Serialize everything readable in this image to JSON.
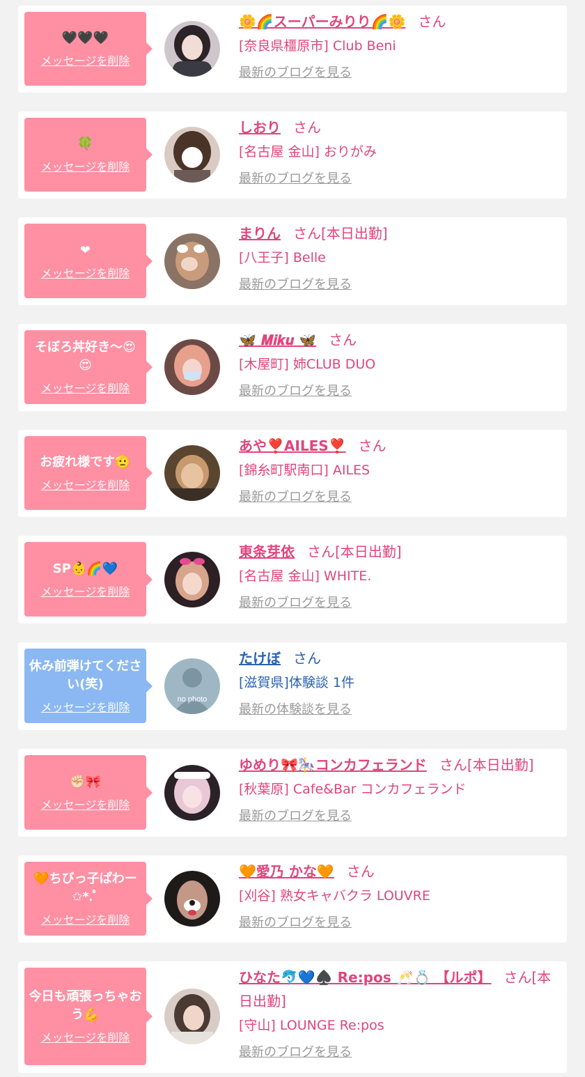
{
  "colors": {
    "background": "#f2f2f2",
    "card": "#ffffff",
    "bubble_pink": "#ff8fa3",
    "bubble_blue": "#8bb8f3",
    "name_pink": "#e0457b",
    "name_blue": "#2a62b0",
    "link_gray": "#999999"
  },
  "delete_label": "メッセージを削除",
  "items": [
    {
      "message": "🖤🖤🖤",
      "name": "🌼🌈スーパーみりり🌈🌼",
      "honorific": "さん",
      "status": "",
      "shop": "[奈良県橿原市] Club Beni",
      "link": "最新のブログを見る",
      "theme": "pink",
      "avatar_icon": "girl-photo-avatar-icon"
    },
    {
      "message": "🍀",
      "name": "しおり",
      "honorific": "さん",
      "status": "",
      "shop": "[名古屋 金山] おりがみ",
      "link": "最新のブログを見る",
      "theme": "pink",
      "avatar_icon": "girl-photo-avatar-icon"
    },
    {
      "message": "❤",
      "name": "まりん",
      "honorific": "さん",
      "status": "[本日出勤]",
      "shop": "[八王子] Belle",
      "link": "最新のブログを見る",
      "theme": "pink",
      "avatar_icon": "girl-photo-avatar-icon"
    },
    {
      "message": "そぼろ丼好き〜😍😍",
      "name": "🦋 𝑴𝒊𝒌𝒖 🦋",
      "honorific": "さん",
      "status": "",
      "shop": "[木屋町] 姉CLUB DUO",
      "link": "最新のブログを見る",
      "theme": "pink",
      "avatar_icon": "girl-photo-avatar-icon"
    },
    {
      "message": "お疲れ様です🫡",
      "name": "あや❣️AILES❣️",
      "honorific": "さん",
      "status": "",
      "shop": "[錦糸町駅南口] AILES",
      "link": "最新のブログを見る",
      "theme": "pink",
      "avatar_icon": "girl-photo-avatar-icon"
    },
    {
      "message": "SP👶🌈💙",
      "name": "東条芽依",
      "honorific": "さん",
      "status": "[本日出勤]",
      "shop": "[名古屋 金山] WHITE.",
      "link": "最新のブログを見る",
      "theme": "pink",
      "avatar_icon": "girl-photo-avatar-icon"
    },
    {
      "message": "休み前弾けてください(笑)",
      "name": "たけぼ",
      "honorific": "さん",
      "status": "",
      "shop": "[滋賀県]体験談 1件",
      "link": "最新の体験談を見る",
      "theme": "blue",
      "avatar_icon": "no-photo-avatar-icon",
      "avatar_text": "no photo"
    },
    {
      "message": "✊🏻🎀",
      "name": "ゆめり🎀🎠コンカフェランド",
      "honorific": "さん",
      "status": "[本日出勤]",
      "shop": "[秋葉原] Cafe&Bar コンカフェランド",
      "link": "最新のブログを見る",
      "theme": "pink",
      "avatar_icon": "girl-photo-avatar-icon"
    },
    {
      "message": "🧡ちびっ子ぱわー✩*.ﾟ",
      "name": "🧡愛乃 かな🧡",
      "honorific": "さん",
      "status": "",
      "shop": "[刈谷] 熟女キャバクラ LOUVRE",
      "link": "最新のブログを見る",
      "theme": "pink",
      "avatar_icon": "girl-photo-avatar-icon"
    },
    {
      "message": "今日も頑張っちゃおう💪",
      "name": "ひなた🐬💙♠️ Re:pos 🥂💍 【ルポ】",
      "honorific": "さん",
      "status": "[本日出勤]",
      "shop": "[守山] LOUNGE Re:pos",
      "link": "最新のブログを見る",
      "theme": "pink",
      "avatar_icon": "girl-photo-avatar-icon"
    }
  ]
}
